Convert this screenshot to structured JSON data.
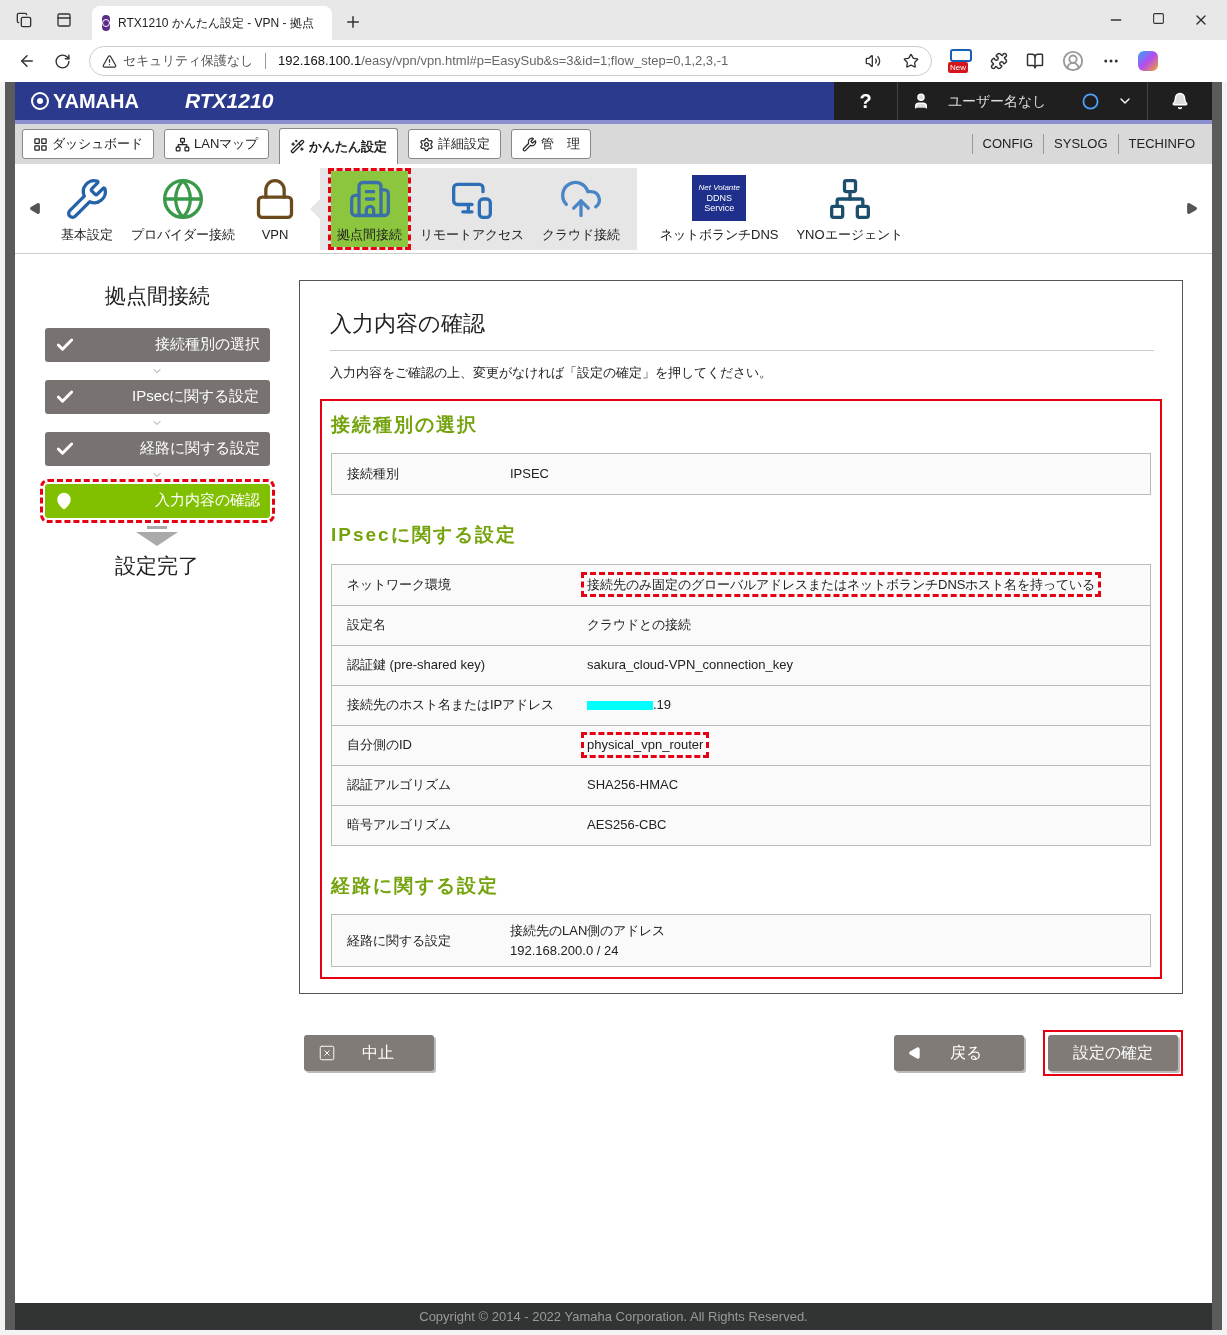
{
  "browser": {
    "tab_title": "RTX1210 かんたん設定 - VPN - 拠点",
    "security_label": "セキュリティ保護なし",
    "url_host": "192.168.100.1",
    "url_path": "/easy/vpn/vpn.html#p=EasySub&s=3&id=1;flow_step=0,1,2,3,-1",
    "new_badge": "New"
  },
  "header": {
    "brand": "YAMAHA",
    "model": "RTX1210",
    "help": "?",
    "user": "ユーザー名なし"
  },
  "tabs": [
    {
      "label": "ダッシュボード",
      "selected": false
    },
    {
      "label": "LANマップ",
      "selected": false
    },
    {
      "label": "かんたん設定",
      "selected": true
    },
    {
      "label": "詳細設定",
      "selected": false
    },
    {
      "label": "管　理",
      "selected": false
    }
  ],
  "top_links": [
    "CONFIG",
    "SYSLOG",
    "TECHINFO"
  ],
  "nav_items": [
    {
      "label": "基本設定",
      "selected": false,
      "annotated": false
    },
    {
      "label": "プロバイダー接続",
      "selected": false,
      "annotated": false
    },
    {
      "label": "VPN",
      "expanded": true,
      "selected": false,
      "annotated": false,
      "children": [
        {
          "label": "拠点間接続",
          "selected": true,
          "annotated": true
        },
        {
          "label": "リモートアクセス",
          "selected": false,
          "annotated": false
        },
        {
          "label": "クラウド接続",
          "selected": false,
          "annotated": false
        }
      ]
    },
    {
      "label": "ネットボランチDNS",
      "badge_lines": [
        "Net Volante",
        "DDNS",
        "Service"
      ],
      "selected": false,
      "annotated": false
    },
    {
      "label": "YNOエージェント",
      "selected": false,
      "annotated": false
    }
  ],
  "sidebar": {
    "title": "拠点間接続",
    "steps": [
      {
        "label": "接続種別の選択",
        "checked": true,
        "selected": false,
        "annotated": false
      },
      {
        "label": "IPsecに関する設定",
        "checked": true,
        "selected": false,
        "annotated": false
      },
      {
        "label": "経路に関する設定",
        "checked": true,
        "selected": false,
        "annotated": false
      },
      {
        "label": "入力内容の確認",
        "checked": false,
        "selected": true,
        "annotated": true
      }
    ],
    "final_step": "設定完了"
  },
  "panel": {
    "title": "入力内容の確認",
    "description": "入力内容をご確認の上、変更がなければ「設定の確定」を押してください。",
    "annotated": true,
    "sections": [
      {
        "title": "接続種別の選択",
        "rows": [
          {
            "label": "接続種別",
            "value": [
              "IPSEC"
            ],
            "masked": false,
            "annotated": false
          }
        ]
      },
      {
        "title": "IPsecに関する設定",
        "rows": [
          {
            "label": "ネットワーク環境",
            "value": [
              "接続先のみ固定のグローバルアドレスまたはネットボランチDNSホスト名を持っている"
            ],
            "masked": false,
            "annotated": true
          },
          {
            "label": "設定名",
            "value": [
              "クラウドとの接続"
            ],
            "masked": false,
            "annotated": false
          },
          {
            "label": "認証鍵 (pre-shared key)",
            "value": [
              "sakura_cloud-VPN_connection_key"
            ],
            "masked": false,
            "annotated": false
          },
          {
            "label": "接続先のホスト名またはIPアドレス",
            "value": [
              ".19"
            ],
            "masked": true,
            "annotated": false
          },
          {
            "label": "自分側のID",
            "value": [
              "physical_vpn_router"
            ],
            "masked": false,
            "annotated": true
          },
          {
            "label": "認証アルゴリズム",
            "value": [
              "SHA256-HMAC"
            ],
            "masked": false,
            "annotated": false
          },
          {
            "label": "暗号アルゴリズム",
            "value": [
              "AES256-CBC"
            ],
            "masked": false,
            "annotated": false
          }
        ]
      },
      {
        "title": "経路に関する設定",
        "rows": [
          {
            "label": "経路に関する設定",
            "value": [
              "接続先のLAN側のアドレス",
              "192.168.200.0 / 24"
            ],
            "masked": false,
            "annotated": false
          }
        ]
      }
    ]
  },
  "buttons": [
    {
      "label": "中止",
      "annotated": false
    },
    {
      "label": "戻る",
      "annotated": false
    },
    {
      "label": "設定の確定",
      "annotated": true
    }
  ],
  "footer": "Copyright © 2014 - 2022 Yamaha Corporation. All Rights Reserved."
}
